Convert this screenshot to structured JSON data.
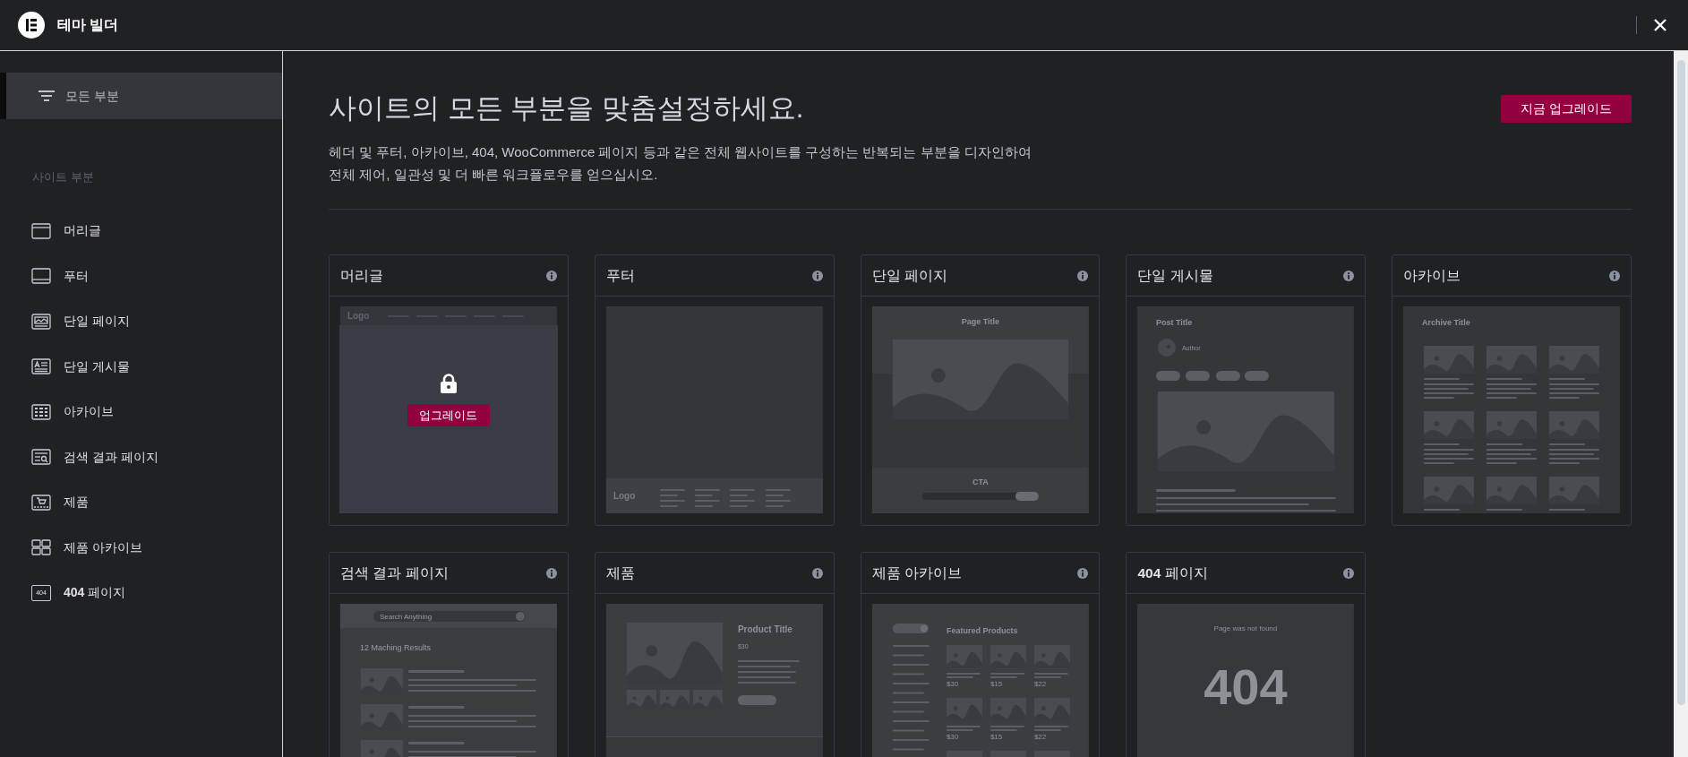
{
  "window": {
    "title": "테마 빌더"
  },
  "sidebar": {
    "filter": {
      "label": "모든 부분",
      "selected": true
    },
    "section_title": "사이트 부분",
    "items": [
      {
        "label": "머리글",
        "selected": false
      },
      {
        "label": "푸터",
        "selected": false
      },
      {
        "label": "단일 페이지",
        "selected": false
      },
      {
        "label": "단일 게시물",
        "selected": false
      },
      {
        "label": "아카이브",
        "selected": false
      },
      {
        "label": "검색 결과 페이지",
        "selected": false
      },
      {
        "label": "제품",
        "selected": false
      },
      {
        "label": "제품 아카이브",
        "selected": false
      },
      {
        "label": "**404** 페이지",
        "selected": false,
        "badge": "404"
      }
    ]
  },
  "main": {
    "heading": "사이트의 모든 부분을 맞춤설정하세요.",
    "upgrade_button": "지금 업그레이드",
    "description": [
      "헤더 및 푸터, 아카이브, 404, WooCommerce 페이지 등과 같은 전체 웹사이트를 구성하는 반복되는 부분을 디자인하여",
      "전체 제어, 일관성 및 더 빠른 워크플로우를 얻으십시오."
    ]
  },
  "cards": [
    {
      "title": "머리글",
      "locked": true,
      "upgrade_label": "업그레이드",
      "preview": {
        "kind": "header",
        "logo": "Logo"
      }
    },
    {
      "title": "푸터",
      "locked": false,
      "preview": {
        "kind": "footer",
        "logo": "Logo"
      }
    },
    {
      "title": "단일 페이지",
      "locked": false,
      "preview": {
        "kind": "single_page",
        "title": "Page Title",
        "cta": "CTA"
      }
    },
    {
      "title": "단일 게시물",
      "locked": false,
      "preview": {
        "kind": "single_post",
        "title": "Post Title",
        "author": "Author"
      }
    },
    {
      "title": "아카이브",
      "locked": false,
      "preview": {
        "kind": "archive",
        "title": "Archive Title"
      }
    },
    {
      "title": "검색 결과 페이지",
      "locked": false,
      "preview": {
        "kind": "search",
        "placeholder": "Search Anything",
        "results": "12 Maching Results"
      }
    },
    {
      "title": "제품",
      "locked": false,
      "preview": {
        "kind": "product",
        "title": "Product Title",
        "price": "$30"
      }
    },
    {
      "title": "제품 아카이브",
      "locked": false,
      "preview": {
        "kind": "product_archive",
        "title": "Featured Products",
        "prices": [
          "$30",
          "$15",
          "$22",
          "$30",
          "$15",
          "$22"
        ]
      }
    },
    {
      "title": "**404** 페이지",
      "locked": false,
      "preview": {
        "kind": "not_found",
        "message": "Page was not found",
        "code": "404"
      }
    }
  ]
}
